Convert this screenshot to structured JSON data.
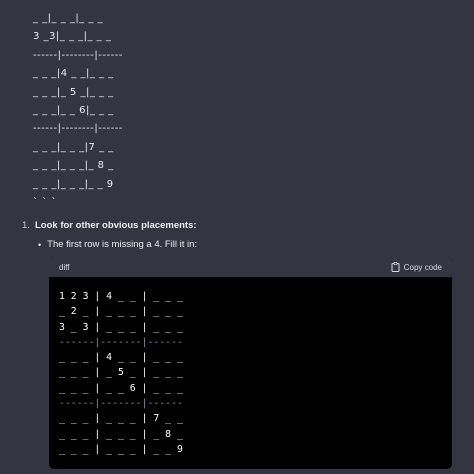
{
  "plain_lines": [
    "_ _|_ _ _|_ _ _",
    "3 _3|_ _ _|_ _ _",
    "------|--------|------",
    "_ _ _|4 _ _|_ _ _",
    "_ _ _|_ 5 _|_ _ _",
    "_ _ _|_ _ 6|_ _ _",
    "------|--------|------",
    "_ _ _|_ _ _|7 _ _",
    "_ _ _|_ _ _|_ 8 _",
    "_ _ _|_ _ _|_ _ 9",
    "` ` `"
  ],
  "list": {
    "number": "1.",
    "title": "Look for other obvious placements:",
    "sub_item": "The first row is missing a 4. Fill it in:"
  },
  "code_block": {
    "language": "diff",
    "copy_label": "Copy code",
    "lines": [
      "1 2 3 | 4 _ _ | _ _ _",
      "_ 2 _ | _ _ _ | _ _ _",
      "3 _ 3 | _ _ _ | _ _ _",
      "------|-------|------",
      "_ _ _ | 4 _ _ | _ _ _",
      "_ _ _ | _ 5 _ | _ _ _",
      "_ _ _ | _ _ 6 | _ _ _",
      "------|-------|------",
      "_ _ _ | _ _ _ | 7 _ _",
      "_ _ _ | _ _ _ | _ 8 _",
      "_ _ _ | _ _ _ | _ _ 9"
    ]
  },
  "colors": {
    "background": "#343541",
    "code_background": "#000000",
    "code_header": "#343541"
  },
  "icons": {
    "copy": "clipboard-icon",
    "bullet": "bullet-dot"
  }
}
